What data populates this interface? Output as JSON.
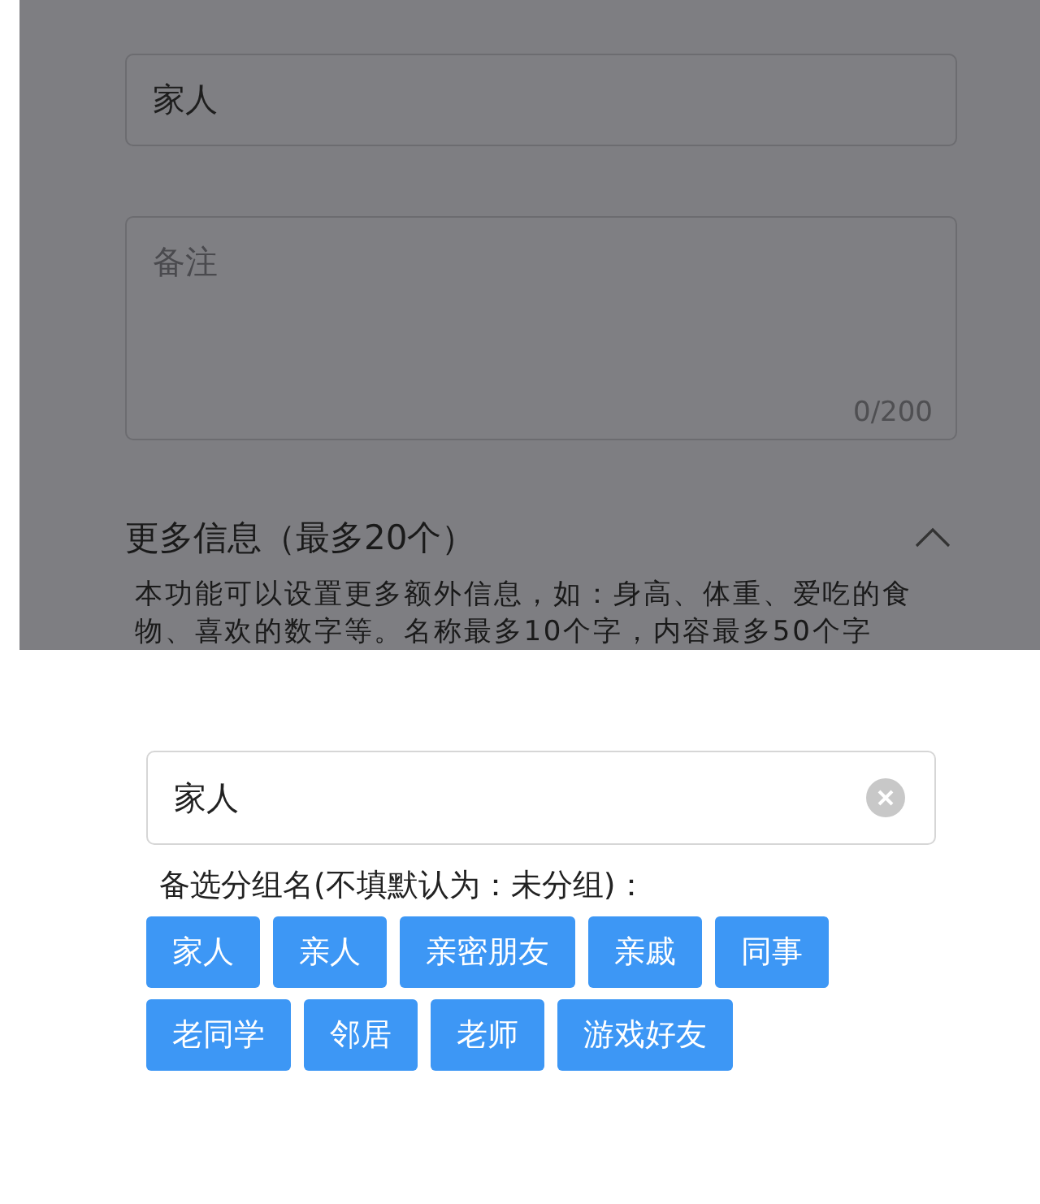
{
  "form": {
    "name_field": {
      "value": "家人"
    },
    "note_field": {
      "placeholder": "备注",
      "counter": "0/200"
    },
    "more_info": {
      "title": "更多信息（最多20个）",
      "expanded": true,
      "description": "本功能可以设置更多额外信息，如：身高、体重、爱吃的食物、喜欢的数字等。名称最多10个字，内容最多50个字"
    }
  },
  "group_sheet": {
    "input": {
      "value": "家人"
    },
    "hint": "备选分组名(不填默认为：未分组)：",
    "tags": [
      "家人",
      "亲人",
      "亲密朋友",
      "亲戚",
      "同事",
      "老同学",
      "邻居",
      "老师",
      "游戏好友"
    ]
  }
}
